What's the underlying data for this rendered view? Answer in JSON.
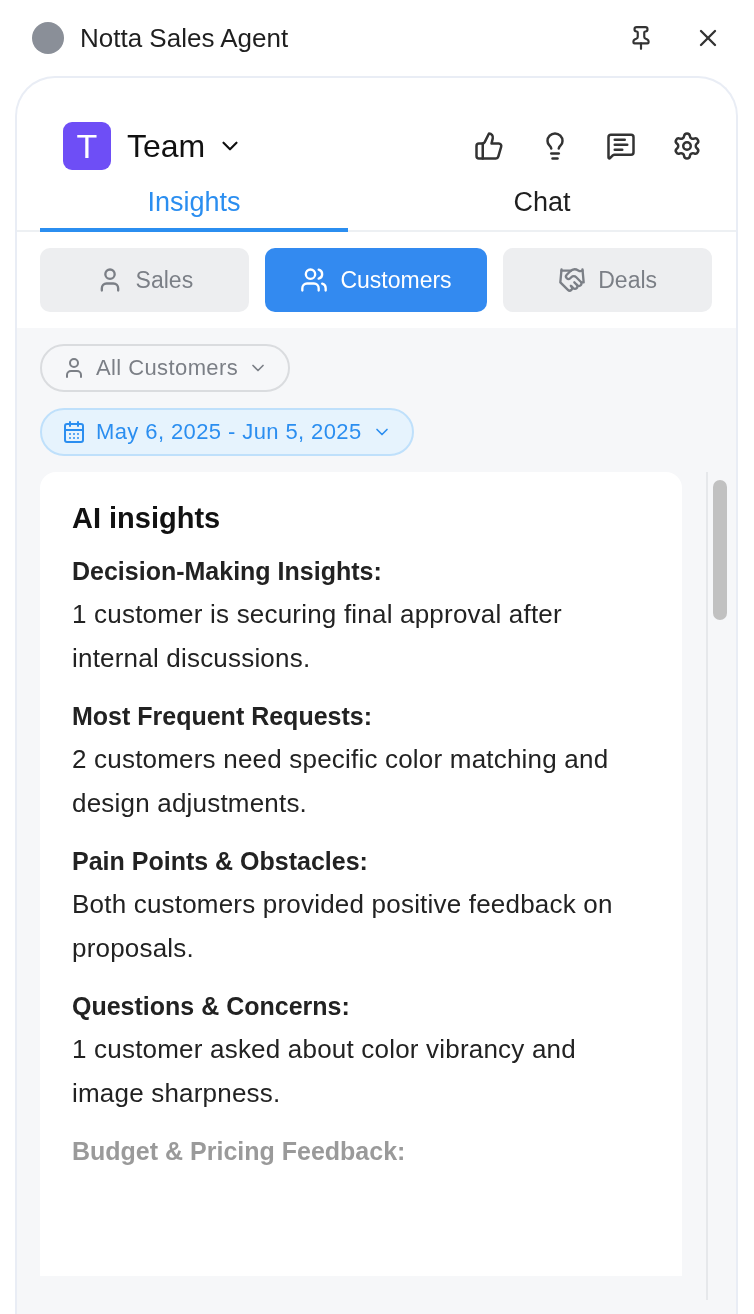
{
  "window": {
    "title": "Notta Sales Agent"
  },
  "workspace": {
    "initial": "T",
    "name": "Team"
  },
  "tabs": [
    {
      "label": "Insights",
      "selected": true
    },
    {
      "label": "Chat",
      "selected": false
    }
  ],
  "segments": [
    {
      "label": "Sales",
      "kind": "user",
      "selected": false
    },
    {
      "label": "Customers",
      "kind": "users",
      "selected": true
    },
    {
      "label": "Deals",
      "kind": "deals",
      "selected": false
    }
  ],
  "filters": [
    {
      "label": "All Customers",
      "kind": "people",
      "selected": false
    },
    {
      "label": "May 6, 2025 - Jun 5, 2025",
      "kind": "date",
      "selected": true
    }
  ],
  "card": {
    "title": "AI insights",
    "sections": [
      {
        "heading": "Decision-Making Insights:",
        "text": "1 customer is securing final approval after internal discussions.",
        "faded": false
      },
      {
        "heading": "Most Frequent Requests:",
        "text": "2 customers need specific color matching and design adjustments.",
        "faded": false
      },
      {
        "heading": "Pain Points & Obstacles:",
        "text": "Both customers provided positive feedback on proposals.",
        "faded": false
      },
      {
        "heading": "Questions & Concerns:",
        "text": "1 customer asked about color vibrancy and image sharpness.",
        "faded": false
      },
      {
        "heading": "Budget & Pricing Feedback:",
        "faded": true
      }
    ]
  }
}
